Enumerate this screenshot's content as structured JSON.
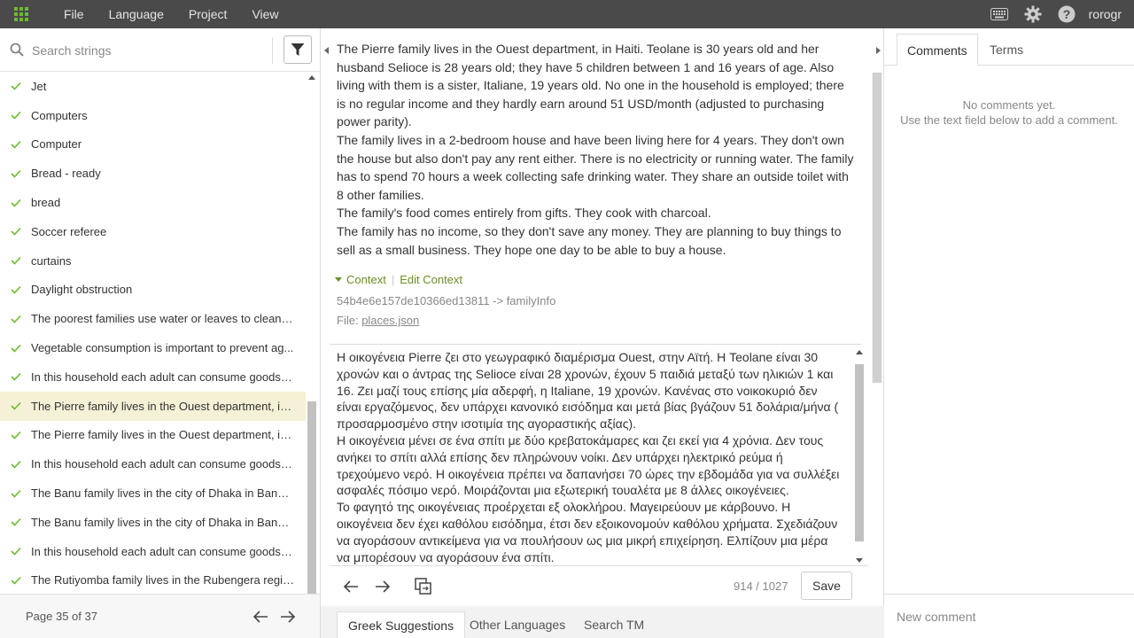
{
  "topbar": {
    "menu": [
      "File",
      "Language",
      "Project",
      "View"
    ],
    "user": "rorogr",
    "accent": "#6dbb2f"
  },
  "search": {
    "placeholder": "Search strings"
  },
  "strings": [
    "Jet",
    "Computers",
    "Computer",
    "Bread - ready",
    "bread",
    "Soccer referee",
    "curtains",
    "Daylight obstruction",
    "The poorest families use water or leaves to clean t...",
    "Vegetable consumption is important to prevent ag...",
    "In this household each adult can consume goods a...",
    "The Pierre family lives in the Ouest department, in ...",
    "The Pierre family lives in the Ouest department, in ...",
    "In this household each adult can consume goods a...",
    "The Banu family lives in the city of Dhaka in Bangla...",
    "The Banu family lives in the city of Dhaka in Bangla...",
    "In this household each adult can consume goods a...",
    "The Rutiyomba family lives in the Rubengera regio..."
  ],
  "active_index": 11,
  "pager": {
    "text": "Page 35 of 37"
  },
  "source": {
    "paragraphs": [
      "The Pierre family lives in the Ouest department, in Haiti. Teolane is 30 years old and her husband Selioce is 28 years old; they have 5 children between 1 and 16 years of age. Also living with them is a sister, Italiane, 19 years old. No one in the household is employed; there is no regular income and they hardly earn around 51 USD/month (adjusted to purchasing power parity).",
      "The family lives in a 2-bedroom house and have been living here for 4 years. They don't own the house but also don't pay any rent either. There is no electricity or running water. The family has to spend 70 hours a week collecting safe drinking water. They share an outside toilet with 8 other families.",
      "The family's food comes entirely from gifts. They cook with charcoal.",
      "The family has no income, so they don't save any money. They are planning to buy things to sell as a small business. They hope one day to be able to buy a house."
    ]
  },
  "context": {
    "label": "Context",
    "edit_label": "Edit Context",
    "key": "54b4e6e157de10366ed13811 -> familyInfo",
    "file_label": "File:",
    "file_name": "places.json"
  },
  "translation": {
    "paragraphs": [
      "Η οικογένεια Pierre ζει στο γεωγραφικό διαμέρισμα Ouest, στην Αϊτή. Η Teolane είναι 30 χρονών και ο άντρας της Selioce είναι 28 χρονών, έχουν 5 παιδιά μεταξύ των ηλικιών 1 και 16. Ζει μαζί τους επίσης μία αδερφή, η Italiane, 19 χρονών. Κανένας στο νοικοκυριό δεν είναι εργαζόμενος, δεν υπάρχει κανονικό εισόδημα και μετά βίας βγάζουν 51 δολάρια/μήνα ( προσαρμοσμένο στην ισοτιμία της αγοραστικής αξίας).",
      "Η οικογένεια μένει σε ένα σπίτι με δύο κρεβατοκάμαρες και ζει εκεί για 4 χρόνια. Δεν τους ανήκει το σπίτι αλλά επίσης δεν πληρώνουν νοίκι. Δεν υπάρχει ηλεκτρικό ρεύμα ή τρεχούμενο νερό. Η οικογένεια πρέπει να δαπανήσει 70 ώρες την εβδομάδα για να συλλέξει ασφαλές πόσιμο νερό. Μοιράζονται μια εξωτερική τουαλέτα με 8 άλλες οικογένειες.",
      "Το φαγητό της οικογένειας προέρχεται εξ ολοκλήρου. Μαγειρεύουν με κάρβουνο. Η οικογένεια δεν έχει καθόλου εισόδημα, έτσι δεν εξοικονομούν καθόλου χρήματα. Σχεδιάζουν να αγοράσουν αντικείμενα για να πουλήσουν ως μια μικρή επιχείρηση. Ελπίζουν μια μέρα να μπορέσουν να αγοράσουν ένα σπίτι."
    ]
  },
  "editor": {
    "counter": "914 / 1027",
    "save_label": "Save"
  },
  "suggestion_tabs": [
    "Greek Suggestions",
    "Other Languages",
    "Search TM"
  ],
  "right": {
    "tabs": [
      "Comments",
      "Terms"
    ],
    "no_comments_line1": "No comments yet.",
    "no_comments_line2": "Use the text field below to add a comment.",
    "new_comment_placeholder": "New comment"
  }
}
